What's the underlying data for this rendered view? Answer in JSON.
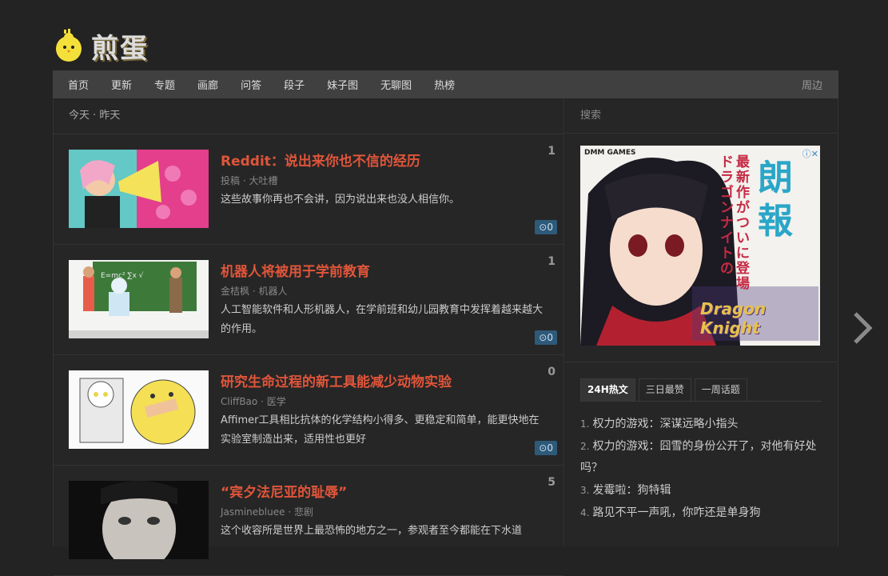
{
  "brand": {
    "name": "煎蛋"
  },
  "nav": {
    "items": [
      "首页",
      "更新",
      "专题",
      "画廊",
      "问答",
      "段子",
      "妹子图",
      "无聊图",
      "热榜"
    ],
    "right": "周边"
  },
  "day_tabs": {
    "today": "今天",
    "sep": " · ",
    "yesterday": "昨天"
  },
  "posts": [
    {
      "title": "Reddit：说出来你也不信的经历",
      "author": "投稿",
      "sep": " · ",
      "tag": "大吐槽",
      "desc": "这些故事你再也不会讲，因为说出来也没人相信你。",
      "count": "1",
      "comments": "⊙0"
    },
    {
      "title": "机器人将被用于学前教育",
      "author": "金桔枫",
      "sep": " · ",
      "tag": "机器人",
      "desc": "人工智能软件和人形机器人，在学前班和幼儿园教育中发挥着越来越大的作用。",
      "count": "1",
      "comments": "⊙0"
    },
    {
      "title": "研究生命过程的新工具能减少动物实验",
      "author": "CliffBao",
      "sep": " · ",
      "tag": "医学",
      "desc": "Affimer工具相比抗体的化学结构小得多、更稳定和简单，能更快地在实验室制造出来，适用性也更好",
      "count": "0",
      "comments": "⊙0"
    },
    {
      "title": "“宾夕法尼亚的耻辱”",
      "author": "Jasminebluee",
      "sep": " · ",
      "tag": "悲剧",
      "desc": "这个收容所是世界上最恐怖的地方之一，参观者至今都能在下水道",
      "count": "5",
      "comments": ""
    }
  ],
  "sidebar": {
    "search_placeholder": "搜索",
    "ad": {
      "brand": "DMM GAMES",
      "close": "ⓘ✕",
      "tagline": "最新作がついに登場",
      "tagline2": "ドラゴンナイトの",
      "big": "朗報",
      "logo": "Dragon Knight"
    },
    "tabs": [
      "24H热文",
      "三日最赞",
      "一周话题"
    ],
    "hot": [
      {
        "idx": "1.",
        "text": "权力的游戏：深谋远略小指头"
      },
      {
        "idx": "2.",
        "text": "权力的游戏：囧雪的身份公开了，对他有好处吗？"
      },
      {
        "idx": "3.",
        "text": "发霉啦：狗特辑"
      },
      {
        "idx": "4.",
        "text": "路见不平一声吼，你咋还是单身狗"
      }
    ]
  },
  "colors": {
    "accent": "#e0553a",
    "bg": "#232323",
    "nav": "#404040",
    "badge": "#2e5a7a"
  },
  "icons": {
    "next": "chevron-right-icon",
    "logo": "chick-icon"
  }
}
